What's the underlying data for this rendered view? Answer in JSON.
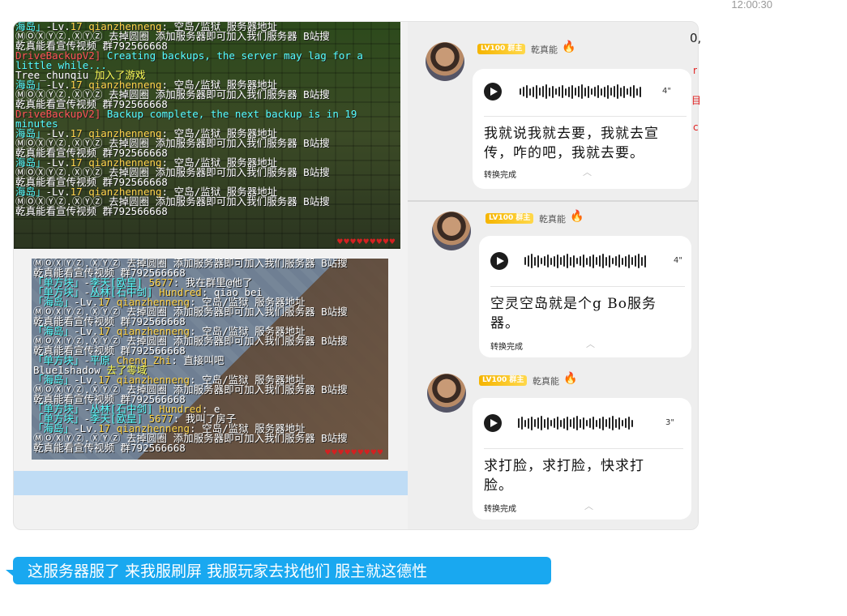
{
  "header": {
    "time": "12:00:30"
  },
  "chat": {
    "mc_top_lines": [
      [
        [
          "tag",
          "海岛」"
        ],
        [
          "",
          "-Lv."
        ],
        [
          "gold",
          "17"
        ],
        [
          "gold",
          "  qianzhenneng"
        ],
        [
          "",
          ": 空岛/监狱 服务器地址"
        ]
      ],
      [
        [
          "",
          "ⓂⓄⓍⓎⓏ.ⓍⓎⓏ 去掉圆圈 添加服务器即可加入我们服务器 B站搜"
        ]
      ],
      [
        [
          "",
          "乾真能看宣传视频 群792566668"
        ]
      ],
      [
        [
          "red",
          "DriveBackupV2]"
        ],
        [
          "aqua",
          " Creating backups, the server may lag for a"
        ]
      ],
      [
        [
          "aqua",
          "little while..."
        ]
      ],
      [
        [
          "",
          "Tree_chunqiu "
        ],
        [
          "yellow",
          "加入了游戏"
        ]
      ],
      [
        [
          "tag",
          "海岛」"
        ],
        [
          "",
          "-Lv."
        ],
        [
          "gold",
          "17"
        ],
        [
          "gold",
          "  qianzhenneng"
        ],
        [
          "",
          ": 空岛/监狱 服务器地址"
        ]
      ],
      [
        [
          "",
          "ⓂⓄⓍⓎⓏ.ⓍⓎⓏ 去掉圆圈 添加服务器即可加入我们服务器 B站搜"
        ]
      ],
      [
        [
          "",
          "乾真能看宣传视频 群792566668"
        ]
      ],
      [
        [
          "red",
          "DriveBackupV2]"
        ],
        [
          "aqua",
          " Backup complete, the next backup is in 19"
        ]
      ],
      [
        [
          "aqua",
          "minutes"
        ]
      ],
      [
        [
          "tag",
          "海岛」"
        ],
        [
          "",
          "-Lv."
        ],
        [
          "gold",
          "17"
        ],
        [
          "gold",
          "  qianzhenneng"
        ],
        [
          "",
          ": 空岛/监狱 服务器地址"
        ]
      ],
      [
        [
          "",
          "ⓂⓄⓍⓎⓏ.ⓍⓎⓏ 去掉圆圈 添加服务器即可加入我们服务器 B站搜"
        ]
      ],
      [
        [
          "",
          "乾真能看宣传视频 群792566668"
        ]
      ],
      [
        [
          "tag",
          "海岛」"
        ],
        [
          "",
          "-Lv."
        ],
        [
          "gold",
          "17"
        ],
        [
          "gold",
          "  qianzhenneng"
        ],
        [
          "",
          ": 空岛/监狱 服务器地址"
        ]
      ],
      [
        [
          "",
          "ⓂⓄⓍⓎⓏ.ⓍⓎⓏ 去掉圆圈 添加服务器即可加入我们服务器 B站搜"
        ]
      ],
      [
        [
          "",
          "乾真能看宣传视频 群792566668"
        ]
      ],
      [
        [
          "tag",
          "海岛」"
        ],
        [
          "",
          "-Lv."
        ],
        [
          "gold",
          "17"
        ],
        [
          "gold",
          "  qianzhenneng"
        ],
        [
          "",
          ": 空岛/监狱 服务器地址"
        ]
      ],
      [
        [
          "",
          "ⓂⓄⓍⓎⓏ.ⓍⓎⓏ 去掉圆圈 添加服务器即可加入我们服务器 B站搜"
        ]
      ],
      [
        [
          "",
          "乾真能看宣传视频 群792566668"
        ]
      ]
    ],
    "mc_bottom_lines": [
      [
        [
          "",
          "ⓂⓄⓍⓎⓏ.ⓍⓎⓏ 去掉圆圈 添加服务器即可加入我们服务器 B站搜"
        ]
      ],
      [
        [
          "",
          "乾真能看宣传视频 群792566668"
        ]
      ],
      [
        [
          "tag",
          "「单方块」"
        ],
        [
          "",
          "-"
        ],
        [
          "tag",
          "李天[欧皇]"
        ],
        [
          "gold",
          " 5677"
        ],
        [
          "",
          ": 我在群里@他了"
        ]
      ],
      [
        [
          "tag",
          "「单方块」"
        ],
        [
          "",
          "-"
        ],
        [
          "tag",
          "丛林[石中剑]"
        ],
        [
          "gold",
          " Hundred"
        ],
        [
          "",
          ": qiao_bei"
        ]
      ],
      [
        [
          "tag",
          "「海岛」"
        ],
        [
          "",
          "-Lv."
        ],
        [
          "gold",
          "17"
        ],
        [
          "gold",
          "  qianzhenneng"
        ],
        [
          "",
          ": 空岛/监狱 服务器地址"
        ]
      ],
      [
        [
          "",
          "ⓂⓄⓍⓎⓏ.ⓍⓎⓏ 去掉圆圈 添加服务器即可加入我们服务器 B站搜"
        ]
      ],
      [
        [
          "",
          "乾真能看宣传视频 群792566668"
        ]
      ],
      [
        [
          "tag",
          "「海岛」"
        ],
        [
          "",
          "-Lv."
        ],
        [
          "gold",
          "17"
        ],
        [
          "gold",
          "  qianzhenneng"
        ],
        [
          "",
          ": 空岛/监狱 服务器地址"
        ]
      ],
      [
        [
          "",
          "ⓂⓄⓍⓎⓏ.ⓍⓎⓏ 去掉圆圈 添加服务器即可加入我们服务器 B站搜"
        ]
      ],
      [
        [
          "",
          "乾真能看宣传视频 群792566668"
        ]
      ],
      [
        [
          "tag",
          "「单方块」"
        ],
        [
          "",
          "-"
        ],
        [
          "tag",
          "平原"
        ],
        [
          "gold",
          " Cheng_Zhi"
        ],
        [
          "",
          ": 直接叫吧"
        ]
      ],
      [
        [
          "",
          "Blue1shadow "
        ],
        [
          "yellow",
          "去了零域"
        ]
      ],
      [
        [
          "tag",
          "「海岛」"
        ],
        [
          "",
          "-Lv."
        ],
        [
          "gold",
          "17"
        ],
        [
          "gold",
          "  qianzhenneng"
        ],
        [
          "",
          ": 空岛/监狱 服务器地址"
        ]
      ],
      [
        [
          "",
          "ⓂⓄⓍⓎⓏ.ⓍⓎⓏ 去掉圆圈 添加服务器即可加入我们服务器 B站搜"
        ]
      ],
      [
        [
          "",
          "乾真能看宣传视频 群792566668"
        ]
      ],
      [
        [
          "tag",
          "「单方块」"
        ],
        [
          "",
          "-"
        ],
        [
          "tag",
          "丛林[石中剑]"
        ],
        [
          "gold",
          " Hundred"
        ],
        [
          "",
          ": e"
        ]
      ],
      [
        [
          "tag",
          "「单方块」"
        ],
        [
          "",
          "-"
        ],
        [
          "tag",
          "李天[欧皇]"
        ],
        [
          "gold",
          " 5677"
        ],
        [
          "",
          ": 我叫了房子"
        ]
      ],
      [
        [
          "tag",
          "「海岛」"
        ],
        [
          "",
          "-Lv."
        ],
        [
          "gold",
          "17"
        ],
        [
          "gold",
          "  qianzhenneng"
        ],
        [
          "",
          ": 空岛/监狱 服务器地址"
        ]
      ],
      [
        [
          "",
          "ⓂⓄⓍⓎⓏ.ⓍⓎⓏ 去掉圆圈 添加服务器即可加入我们服务器 B站搜"
        ]
      ],
      [
        [
          "",
          "乾真能看宣传视频 群792566668"
        ]
      ]
    ],
    "voice_messages": [
      {
        "badge": "LV100 群主",
        "nick": "乾真能",
        "duration": "4\"",
        "text": "我就说我就去要，我就去宣传，咋的吧，我就去要。",
        "status": "转换完成"
      },
      {
        "badge": "LV100 群主",
        "nick": "乾真能",
        "duration": "4\"",
        "text": "空灵空岛就是个g Bo服务器。",
        "status": "转换完成"
      },
      {
        "badge": "LV100 群主",
        "nick": "乾真能",
        "duration": "3\"",
        "text": "求打脸，求打脸，快求打脸。",
        "status": "转换完成"
      }
    ],
    "side_glyphs": [
      "0,",
      "r",
      "目",
      "c"
    ],
    "outgoing_message": "这服务器服了 来我服刷屏 我服玩家去找他们 服主就这德性"
  }
}
